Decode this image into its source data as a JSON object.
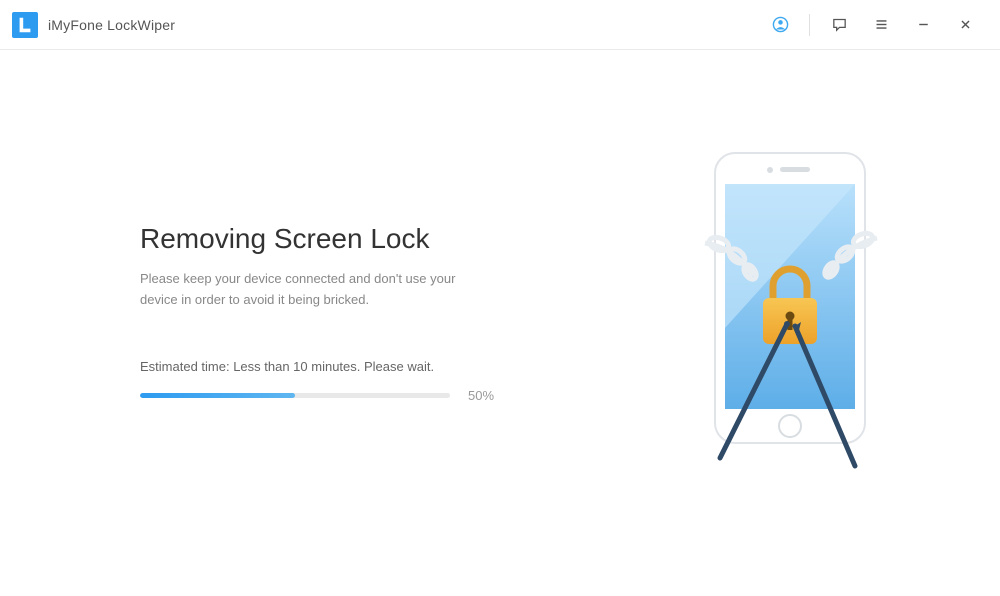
{
  "app": {
    "title": "iMyFone LockWiper"
  },
  "main": {
    "heading": "Removing Screen Lock",
    "subtext": "Please keep your device connected and don't use your device in order to avoid it being bricked.",
    "estimate": "Estimated time: Less than 10 minutes. Please wait.",
    "progress_percent": 50,
    "progress_label": "50%"
  },
  "colors": {
    "accent": "#2d9bf0",
    "lock_yellow": "#f5b93e",
    "lock_orange": "#e89b1c"
  }
}
